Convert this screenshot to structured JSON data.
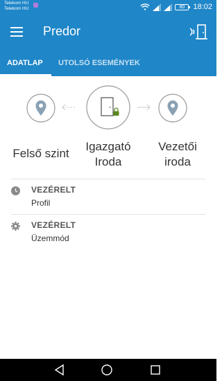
{
  "status_bar": {
    "carrier_line1": "Telekom HU",
    "carrier_line2": "Telekom HU",
    "battery": "80",
    "time": "18:02",
    "icons": [
      "wifi-icon",
      "signal-icon",
      "signal-icon",
      "battery-icon"
    ]
  },
  "app_bar": {
    "title": "Predor",
    "menu_icon": "hamburger-menu-icon",
    "action_icon": "door-signal-icon"
  },
  "tabs": [
    {
      "label": "ADATLAP",
      "active": true
    },
    {
      "label": "UTOLSÓ ESEMÉNYEK",
      "active": false
    }
  ],
  "route": {
    "from": {
      "label": "Felső szint",
      "icon": "location-pin-icon"
    },
    "current": {
      "label": "Igazgató\nIroda",
      "icon": "door-locked-icon"
    },
    "to": {
      "label": "Vezetői\niroda",
      "icon": "location-pin-icon"
    }
  },
  "details": [
    {
      "title": "VEZÉRELT",
      "subtitle": "Profil",
      "icon": "clock-icon"
    },
    {
      "title": "VEZÉRELT",
      "subtitle": "Üzemmód",
      "icon": "gear-icon"
    }
  ],
  "colors": {
    "primary": "#1f86c8",
    "lock": "#5a8a1e",
    "icon_gray": "#8a8a8a"
  }
}
